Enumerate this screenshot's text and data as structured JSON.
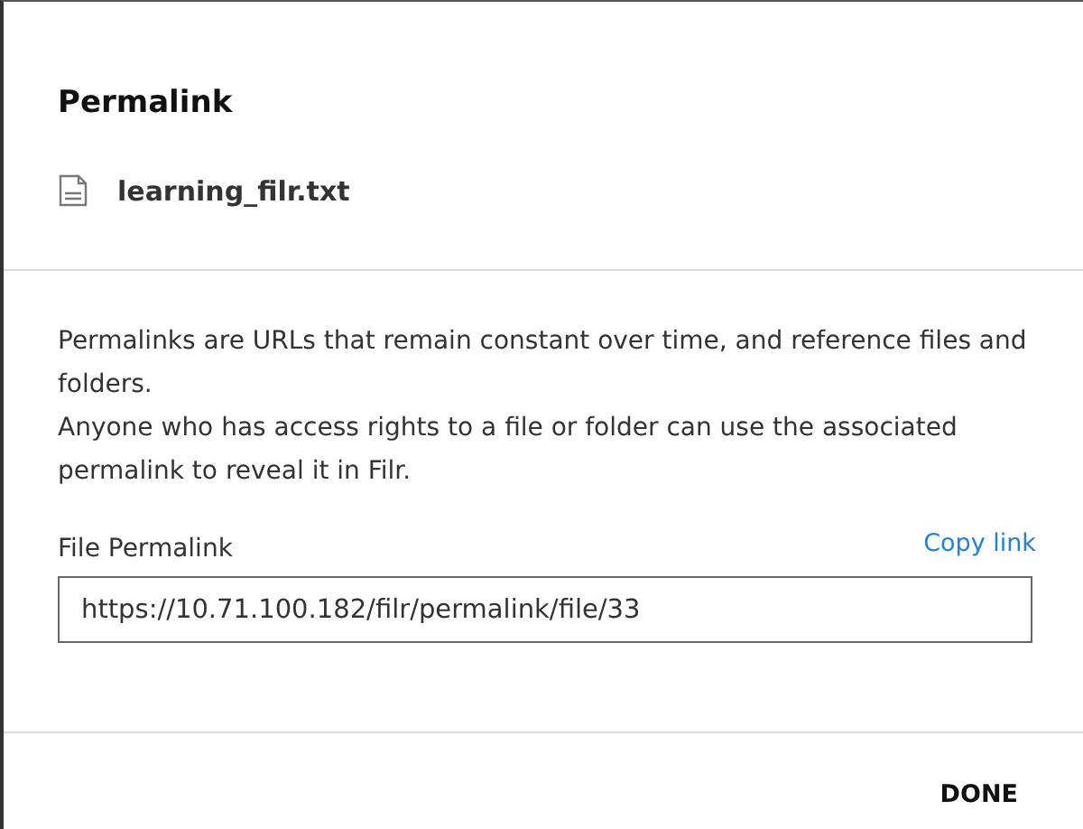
{
  "dialog": {
    "title": "Permalink",
    "file_name": "learning_filr.txt",
    "description": [
      "Permalinks are URLs that remain constant over time, and reference files and folders.",
      "Anyone who has access rights to a file or folder can use the associated permalink to reveal it in Filr."
    ],
    "field": {
      "label": "File Permalink",
      "value": "https://10.71.100.182/filr/permalink/file/33",
      "action": "Copy link"
    },
    "buttons": [
      "DONE"
    ]
  }
}
